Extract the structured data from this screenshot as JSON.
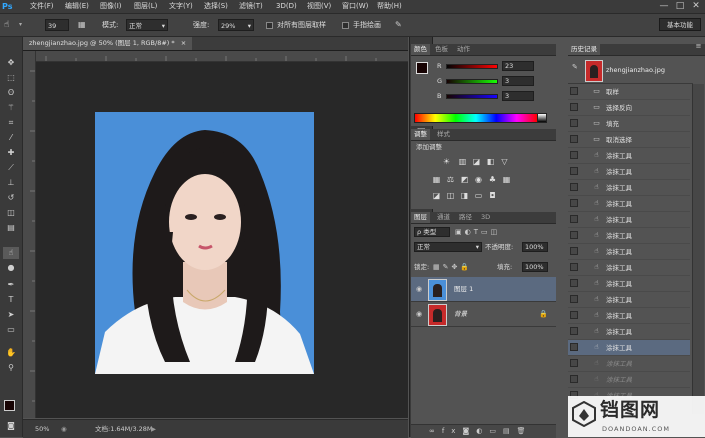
{
  "menubar": {
    "logo": "Ps",
    "items": [
      "文件(F)",
      "编辑(E)",
      "图像(I)",
      "图层(L)",
      "文字(Y)",
      "选择(S)",
      "滤镜(T)",
      "3D(D)",
      "视图(V)",
      "窗口(W)",
      "帮助(H)"
    ],
    "minimize": "—",
    "maximize": "□",
    "close": "✕"
  },
  "options": {
    "brush_size": "39",
    "mode_label": "模式:",
    "mode_value": "正常",
    "strength_label": "强度:",
    "strength_value": "29%",
    "sample_all_label": "对所有图层取样",
    "finger_label": "手指绘画",
    "workspace": "基本功能"
  },
  "document": {
    "tab_title": "zhengjianzhao.jpg @ 50% (图层 1, RGB/8#) *",
    "tab_close": "×"
  },
  "status": {
    "zoom": "50%",
    "doc_info": "文档:1.64M/3.28M"
  },
  "color_panel": {
    "tabs": [
      "颜色",
      "色板",
      "动作"
    ],
    "r_label": "R",
    "g_label": "G",
    "b_label": "B",
    "r_value": "23",
    "g_value": "3",
    "b_value": "3"
  },
  "adjust_panel": {
    "tabs": [
      "调整",
      "样式"
    ],
    "title": "添加调整"
  },
  "layers_panel": {
    "tabs": [
      "图层",
      "通道",
      "路径",
      "3D"
    ],
    "kind_label": "ρ 类型",
    "blend_mode": "正常",
    "opacity_label": "不透明度:",
    "opacity_value": "100%",
    "lock_label": "锁定:",
    "fill_label": "填充:",
    "fill_value": "100%",
    "layers": [
      {
        "name": "图层 1",
        "selected": true
      },
      {
        "name": "背景",
        "selected": false
      }
    ]
  },
  "history_panel": {
    "tab": "历史记录",
    "snapshot": "zhengjianzhao.jpg",
    "items": [
      {
        "label": "取样",
        "dim": false
      },
      {
        "label": "选择反向",
        "dim": false
      },
      {
        "label": "填充",
        "dim": false
      },
      {
        "label": "取消选择",
        "dim": false
      },
      {
        "label": "涂抹工具",
        "dim": false
      },
      {
        "label": "涂抹工具",
        "dim": false
      },
      {
        "label": "涂抹工具",
        "dim": false
      },
      {
        "label": "涂抹工具",
        "dim": false
      },
      {
        "label": "涂抹工具",
        "dim": false
      },
      {
        "label": "涂抹工具",
        "dim": false
      },
      {
        "label": "涂抹工具",
        "dim": false
      },
      {
        "label": "涂抹工具",
        "dim": false
      },
      {
        "label": "涂抹工具",
        "dim": false
      },
      {
        "label": "涂抹工具",
        "dim": false
      },
      {
        "label": "涂抹工具",
        "dim": false
      },
      {
        "label": "涂抹工具",
        "dim": false
      },
      {
        "label": "涂抹工具",
        "dim": false
      },
      {
        "label": "涂抹工具",
        "dim": true
      },
      {
        "label": "涂抹工具",
        "dim": true
      },
      {
        "label": "涂抹工具",
        "dim": true
      },
      {
        "label": "涂抹工具",
        "dim": true
      }
    ]
  },
  "watermark": {
    "brand": "铛图网",
    "url": "DOANDOAN.COM"
  },
  "colors": {
    "photo_background": "#4a8fd8",
    "selected_layer": "#5b6a80",
    "accent": "#31a8ff"
  }
}
